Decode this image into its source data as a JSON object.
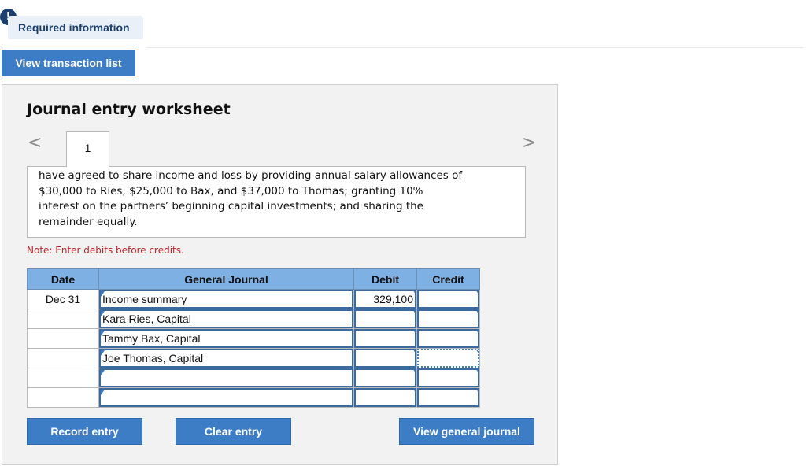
{
  "header": {
    "badge": "!",
    "required_label": "Required information",
    "view_transaction_list": "View transaction list"
  },
  "worksheet": {
    "title": "Journal entry worksheet",
    "nav_prev": "<",
    "nav_next": ">",
    "tabs": [
      {
        "label": "1",
        "selected": true
      }
    ],
    "description": "have agreed to share income and loss by providing annual salary allowances of\n$30,000 to Ries, $25,000 to Bax, and $37,000 to Thomas; granting 10%\ninterest on the partners’ beginning capital investments; and sharing the\nremainder equally.",
    "note": "Note: Enter debits before credits."
  },
  "journal": {
    "headers": {
      "date": "Date",
      "general_journal": "General Journal",
      "debit": "Debit",
      "credit": "Credit"
    },
    "rows": [
      {
        "date": "Dec 31",
        "account": "Income summary",
        "debit": "329,100",
        "credit": ""
      },
      {
        "date": "",
        "account": "Kara Ries, Capital",
        "debit": "",
        "credit": ""
      },
      {
        "date": "",
        "account": "Tammy Bax, Capital",
        "debit": "",
        "credit": ""
      },
      {
        "date": "",
        "account": "Joe Thomas, Capital",
        "debit": "",
        "credit": ""
      },
      {
        "date": "",
        "account": "",
        "debit": "",
        "credit": ""
      },
      {
        "date": "",
        "account": "",
        "debit": "",
        "credit": ""
      }
    ]
  },
  "actions": {
    "record_entry": "Record entry",
    "clear_entry": "Clear entry",
    "view_general_journal": "View general journal"
  },
  "colors": {
    "button_blue": "#3d7dc5",
    "header_blue": "#7fb0e4",
    "note_red": "#c0242a",
    "badge_navy": "#1b3f6e"
  }
}
